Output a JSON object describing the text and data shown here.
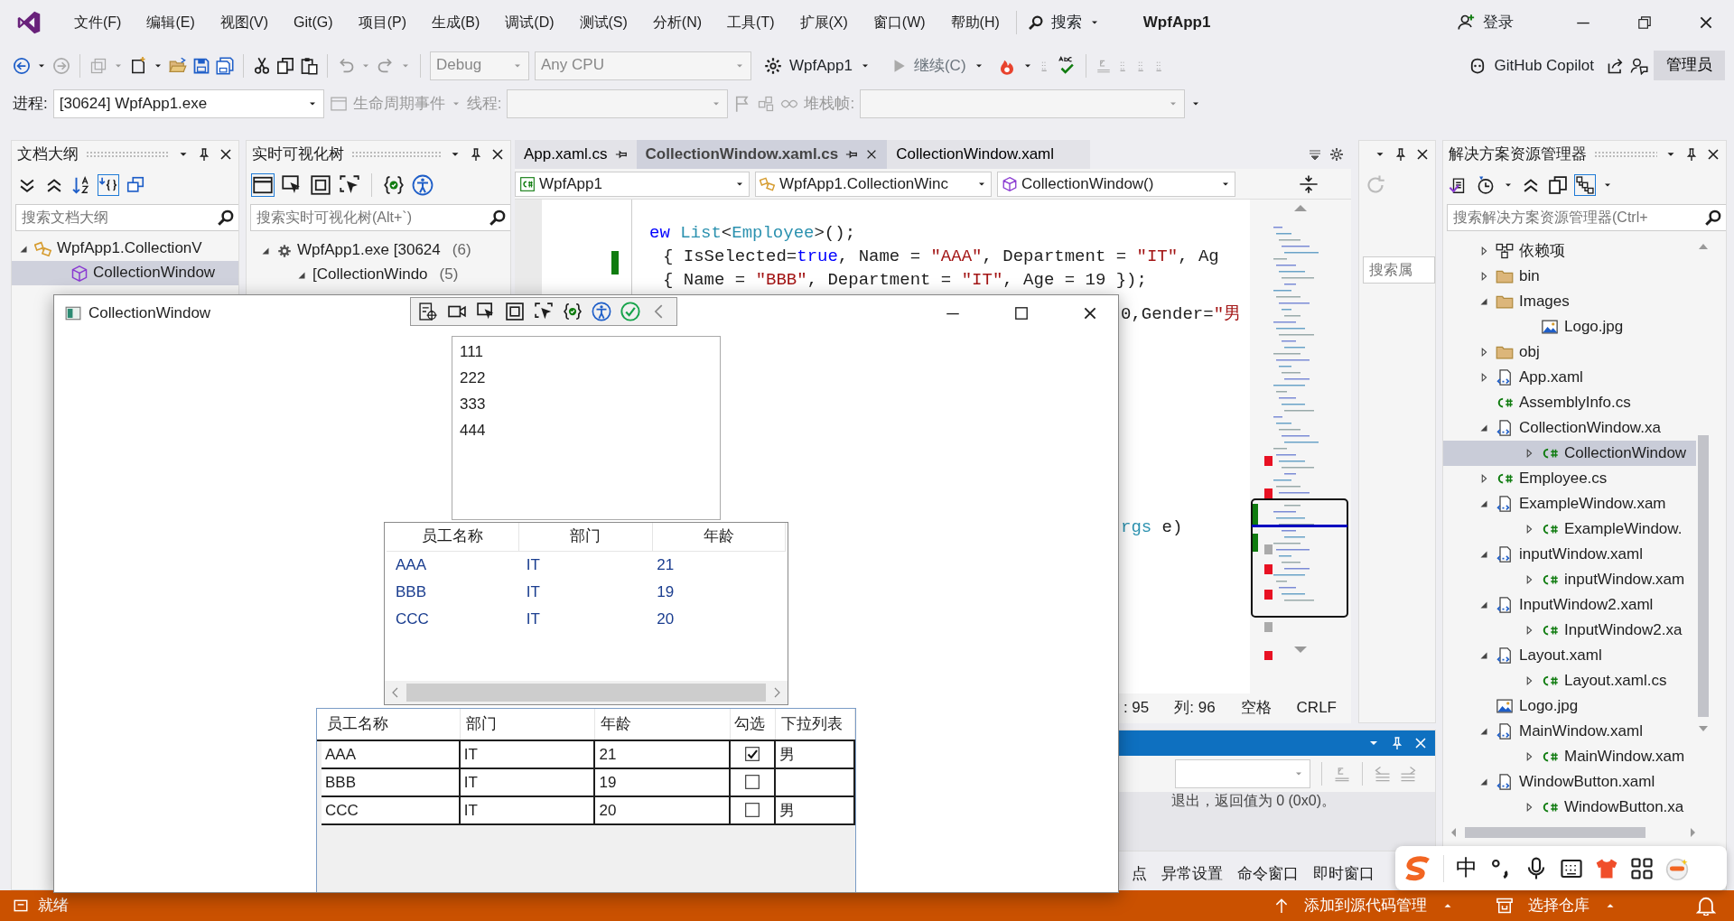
{
  "menu": {
    "items": [
      "文件(F)",
      "编辑(E)",
      "视图(V)",
      "Git(G)",
      "项目(P)",
      "生成(B)",
      "调试(D)",
      "测试(S)",
      "分析(N)",
      "工具(T)",
      "扩展(X)",
      "窗口(W)",
      "帮助(H)"
    ],
    "search": "搜索",
    "title": "WpfApp1",
    "login": "登录"
  },
  "toolbar": {
    "configuration": "Debug",
    "platform": "Any CPU",
    "startup": "WpfApp1",
    "continue": "继续(C)",
    "copilot": "GitHub Copilot",
    "admin": "管理员"
  },
  "debug_bar": {
    "process_label": "进程:",
    "process": "[30624] WpfApp1.exe",
    "lifecycle": "生命周期事件",
    "thread_label": "线程:",
    "stack_label": "堆栈帧:"
  },
  "document_outline": {
    "title": "文档大纲",
    "search": {
      "placeholder": "搜索文档大纲"
    },
    "tree": [
      {
        "label": "WpfApp1.CollectionV",
        "kind": "class",
        "expanded": true,
        "selected": false,
        "children": [
          {
            "label": "CollectionWindow",
            "kind": "member",
            "selected": true
          }
        ]
      }
    ]
  },
  "live_tree": {
    "title": "实时可视化树",
    "search": {
      "placeholder": "搜索实时可视化树(Alt+`)"
    },
    "tree": [
      {
        "label": "WpfApp1.exe [30624",
        "count": "(6)",
        "expanded": true,
        "children": [
          {
            "label": "[CollectionWindo",
            "count": "(5)",
            "expanded": true
          }
        ]
      }
    ]
  },
  "editor": {
    "tabs": [
      {
        "label": "App.xaml.cs",
        "selected": false,
        "pinned": true
      },
      {
        "label": "CollectionWindow.xaml.cs",
        "selected": true,
        "pinned": true
      },
      {
        "label": "CollectionWindow.xaml",
        "selected": false,
        "pinned": false
      }
    ],
    "nav": [
      {
        "kind": "project",
        "label": "WpfApp1"
      },
      {
        "kind": "class",
        "label": "WpfApp1.CollectionWinc"
      },
      {
        "kind": "member",
        "label": "CollectionWindow()"
      }
    ],
    "code": [
      {
        "kind": "full",
        "tokens": [
          {
            "kind": "keyword",
            "text": "ew"
          },
          {
            "kind": "type",
            "text": " List"
          },
          {
            "kind": "plain",
            "text": "<"
          },
          {
            "kind": "type",
            "text": "Employee"
          },
          {
            "kind": "plain",
            "text": ">();"
          }
        ]
      },
      {
        "kind": "full",
        "tokens": [
          {
            "kind": "plain",
            "text": "{ IsSelected="
          },
          {
            "kind": "keyword",
            "text": "true"
          },
          {
            "kind": "plain",
            "text": ", Name = "
          },
          {
            "kind": "string",
            "text": "\"AAA\""
          },
          {
            "kind": "plain",
            "text": ", Department = "
          },
          {
            "kind": "string",
            "text": "\"IT\""
          },
          {
            "kind": "plain",
            "text": ", Ag"
          }
        ]
      },
      {
        "kind": "full",
        "tokens": [
          {
            "kind": "plain",
            "text": "{ Name = "
          },
          {
            "kind": "string",
            "text": "\"BBB\""
          },
          {
            "kind": "plain",
            "text": ", Department = "
          },
          {
            "kind": "string",
            "text": "\"IT\""
          },
          {
            "kind": "plain",
            "text": ", Age = 19 });"
          }
        ]
      },
      {
        "kind": "partial",
        "tokens": [
          {
            "kind": "plain",
            "text": "0,Gender="
          },
          {
            "kind": "string",
            "text": "\"男"
          }
        ]
      },
      {
        "kind": "partial",
        "tokens": [
          {
            "kind": "type",
            "text": "rgs"
          },
          {
            "kind": "plain",
            "text": " e)"
          }
        ]
      }
    ],
    "status": [
      ": 95",
      "列: 96",
      "空格",
      "CRLF"
    ]
  },
  "properties": {
    "search": {
      "placeholder": "搜索属"
    }
  },
  "output": {
    "text": "退出，返回值为 0 (0x0)。"
  },
  "bottom_tabs": [
    "点",
    "异常设置",
    "命令窗口",
    "即时窗口"
  ],
  "solution_explorer": {
    "title": "解决方案资源管理器",
    "search": {
      "placeholder": "搜索解决方案资源管理器(Ctrl+"
    },
    "tree": [
      {
        "label": "依赖项",
        "kind": "deps",
        "expanded": false,
        "selected": false
      },
      {
        "label": "bin",
        "kind": "folder",
        "expanded": false,
        "selected": false
      },
      {
        "label": "Images",
        "kind": "folder",
        "expanded": true,
        "selected": false,
        "children": [
          {
            "label": "Logo.jpg",
            "kind": "image",
            "selected": false
          }
        ]
      },
      {
        "label": "obj",
        "kind": "folder",
        "expanded": false,
        "selected": false
      },
      {
        "label": "App.xaml",
        "kind": "xaml",
        "expanded": false,
        "selected": false
      },
      {
        "label": "AssemblyInfo.cs",
        "kind": "cs",
        "selected": false
      },
      {
        "label": "CollectionWindow.xa",
        "kind": "xaml",
        "expanded": true,
        "selected": false,
        "children": [
          {
            "label": "CollectionWindow",
            "kind": "cs",
            "expanded": false,
            "selected": true
          }
        ]
      },
      {
        "label": "Employee.cs",
        "kind": "cs",
        "expanded": false,
        "selected": false
      },
      {
        "label": "ExampleWindow.xam",
        "kind": "xaml",
        "expanded": true,
        "selected": false,
        "children": [
          {
            "label": "ExampleWindow.",
            "kind": "cs",
            "expanded": false,
            "selected": false
          }
        ]
      },
      {
        "label": "inputWindow.xaml",
        "kind": "xaml",
        "expanded": true,
        "selected": false,
        "children": [
          {
            "label": "inputWindow.xam",
            "kind": "cs",
            "expanded": false,
            "selected": false
          }
        ]
      },
      {
        "label": "InputWindow2.xaml",
        "kind": "xaml",
        "expanded": true,
        "selected": false,
        "children": [
          {
            "label": "InputWindow2.xa",
            "kind": "cs",
            "expanded": false,
            "selected": false
          }
        ]
      },
      {
        "label": "Layout.xaml",
        "kind": "xaml",
        "expanded": true,
        "selected": false,
        "children": [
          {
            "label": "Layout.xaml.cs",
            "kind": "cs",
            "expanded": false,
            "selected": false
          }
        ]
      },
      {
        "label": "Logo.jpg",
        "kind": "image",
        "selected": false
      },
      {
        "label": "MainWindow.xaml",
        "kind": "xaml",
        "expanded": true,
        "selected": false,
        "children": [
          {
            "label": "MainWindow.xam",
            "kind": "cs",
            "expanded": false,
            "selected": false
          }
        ]
      },
      {
        "label": "WindowButton.xaml",
        "kind": "xaml",
        "expanded": true,
        "selected": false,
        "children": [
          {
            "label": "WindowButton.xa",
            "kind": "cs",
            "expanded": false,
            "selected": false
          }
        ]
      }
    ]
  },
  "wpf_window": {
    "title": "CollectionWindow",
    "list": [
      "111",
      "222",
      "333",
      "444"
    ],
    "listview": {
      "columns": [
        "员工名称",
        "部门",
        "年龄"
      ],
      "rows": [
        [
          "AAA",
          "IT",
          "21"
        ],
        [
          "BBB",
          "IT",
          "19"
        ],
        [
          "CCC",
          "IT",
          "20"
        ]
      ]
    },
    "datagrid": {
      "columns": [
        "员工名称",
        "部门",
        "年龄",
        "勾选",
        "下拉列表"
      ],
      "rows": [
        {
          "cells": [
            "AAA",
            "IT",
            "21"
          ],
          "checked": true,
          "dropdown": "男"
        },
        {
          "cells": [
            "BBB",
            "IT",
            "19"
          ],
          "checked": false
        },
        {
          "cells": [
            "CCC",
            "IT",
            "20"
          ],
          "checked": false,
          "dropdown": "男"
        }
      ]
    }
  },
  "ime": {
    "mode": "中"
  },
  "status_bar": {
    "text": "就绪",
    "source_control": "添加到源代码管理",
    "repository": "选择仓库"
  }
}
